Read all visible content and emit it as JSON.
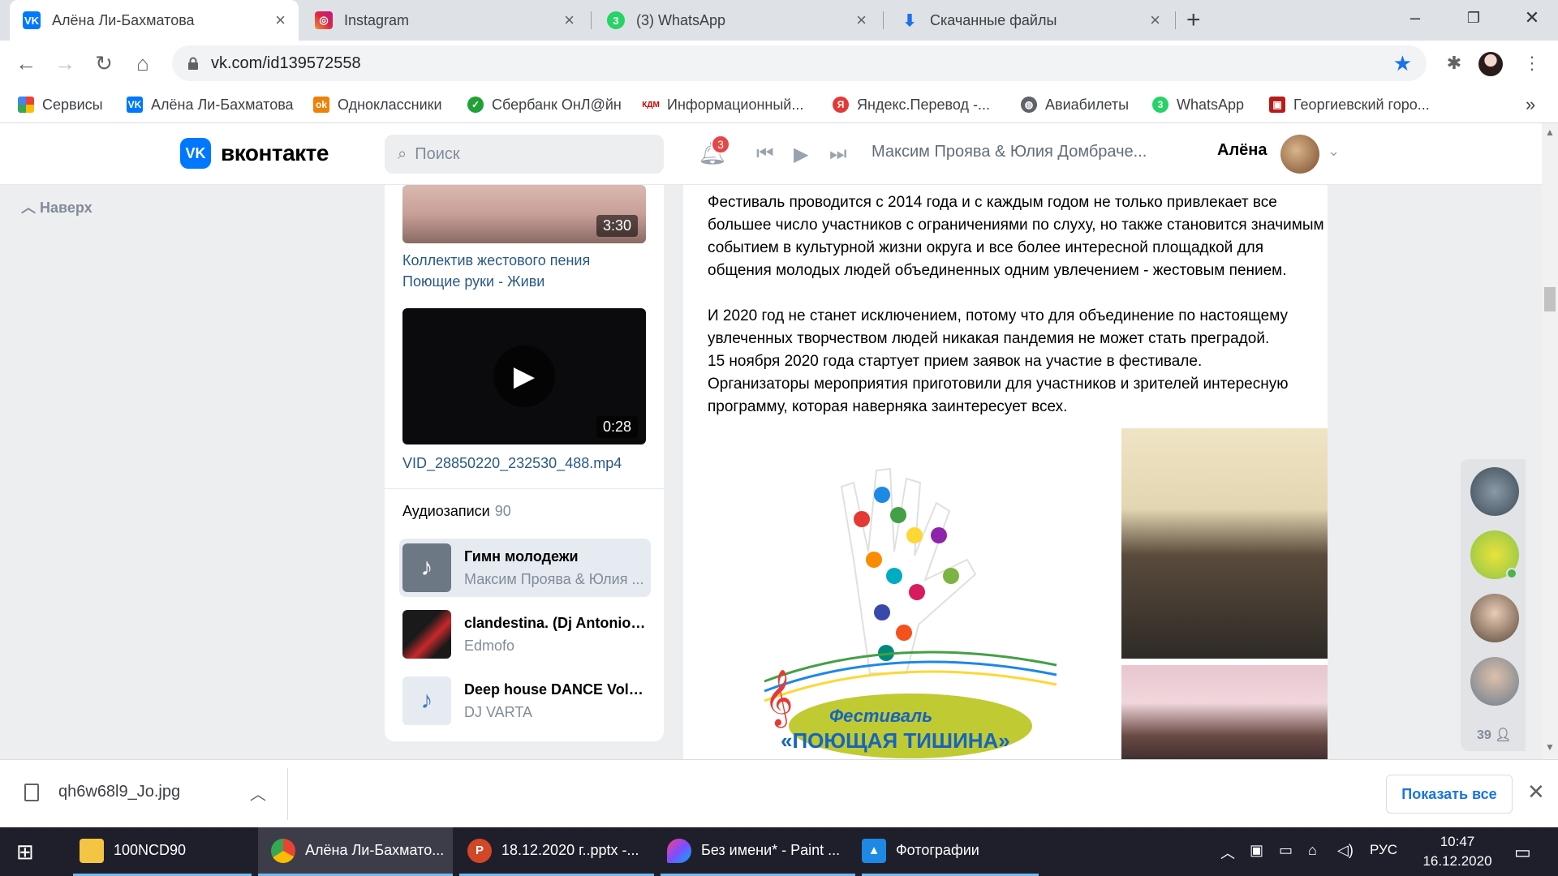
{
  "browser": {
    "tabs": [
      {
        "title": "Алёна Ли-Бахматова",
        "icon": "vk-icon"
      },
      {
        "title": "Instagram",
        "icon": "instagram-icon"
      },
      {
        "title": "(3) WhatsApp",
        "icon": "whatsapp-icon"
      },
      {
        "title": "Скачанные файлы",
        "icon": "download-icon"
      }
    ],
    "new_tab": "+",
    "url": "vk.com/id139572558",
    "bookmarks": [
      {
        "label": "Сервисы",
        "icon": "apps-icon"
      },
      {
        "label": "Алёна Ли-Бахматова",
        "icon": "vk-icon"
      },
      {
        "label": "Одноклассники",
        "icon": "ok-icon"
      },
      {
        "label": "Сбербанк ОнЛ@йн",
        "icon": "sberbank-icon"
      },
      {
        "label": "Информационный...",
        "icon": "kdm-icon"
      },
      {
        "label": "Яндекс.Перевод -...",
        "icon": "yandex-translate-icon"
      },
      {
        "label": "Авиабилеты",
        "icon": "globe-icon"
      },
      {
        "label": "WhatsApp",
        "icon": "whatsapp-icon"
      },
      {
        "label": "Георгиевский горо...",
        "icon": "city-icon"
      }
    ],
    "bookmarks_more": "»"
  },
  "vk": {
    "logo_text": "вконтакте",
    "search_placeholder": "Поиск",
    "notifications_count": "3",
    "now_playing": "Максим Проява & Юлия Домбраче...",
    "user_name": "Алёна",
    "back_to_top": "Наверх"
  },
  "left_column": {
    "videos": [
      {
        "duration": "3:30",
        "title": "Коллектив жестового пения Поющие руки - Живи"
      },
      {
        "duration": "0:28",
        "title": "VID_28850220_232530_488.mp4"
      }
    ],
    "audio_header": "Аудиозаписи",
    "audio_count": "90",
    "tracks": [
      {
        "title": "Гимн молодежи",
        "artist": "Максим Проява & Юлия ...",
        "playing": true
      },
      {
        "title": "clandestina. (Dj Antonio ...",
        "artist": "Edmofo",
        "playing": false
      },
      {
        "title": "Deep house DANCE Vol 1 ...",
        "artist": "DJ VARTA",
        "playing": false
      }
    ]
  },
  "post": {
    "paragraphs": [
      "Фестиваль проводится с 2014 года и с каждым годом не только привлекает все большее число участников с ограничениями по слуху, но также становится значимым событием в культурной жизни округа и все более интересной площадкой для общения молодых людей объединенных одним увлечением - жестовым пением.",
      "И 2020 год не станет исключением, потому что для объединение по настоящему увлеченных творчеством людей никакая пандемия не может стать преградой.",
      "15 ноября 2020 года стартует прием заявок на участие в фестивале.",
      "Организаторы мероприятия приготовили для участников и зрителей интересную программу, которая наверняка заинтересует всех."
    ],
    "poster_line1": "Фестиваль",
    "poster_line2": "«ПОЮЩАЯ ТИШИНА»"
  },
  "friends_online_count": "39",
  "download_shelf": {
    "file_name": "qh6w68l9_Jo.jpg",
    "show_all": "Показать все"
  },
  "taskbar": {
    "items": [
      {
        "label": "100NCD90",
        "icon": "folder-icon"
      },
      {
        "label": "Алёна Ли-Бахмато...",
        "icon": "chrome-icon"
      },
      {
        "label": "18.12.2020 г..pptx -...",
        "icon": "powerpoint-icon"
      },
      {
        "label": "Без имени* - Paint ...",
        "icon": "paint3d-icon"
      },
      {
        "label": "Фотографии",
        "icon": "photos-icon"
      }
    ],
    "language": "РУС",
    "time": "10:47",
    "date": "16.12.2020"
  },
  "colors": {
    "vk_blue": "#0077ff",
    "link": "#2a5885",
    "chrome_accent": "#1a73e8",
    "badge_red": "#e64646"
  }
}
